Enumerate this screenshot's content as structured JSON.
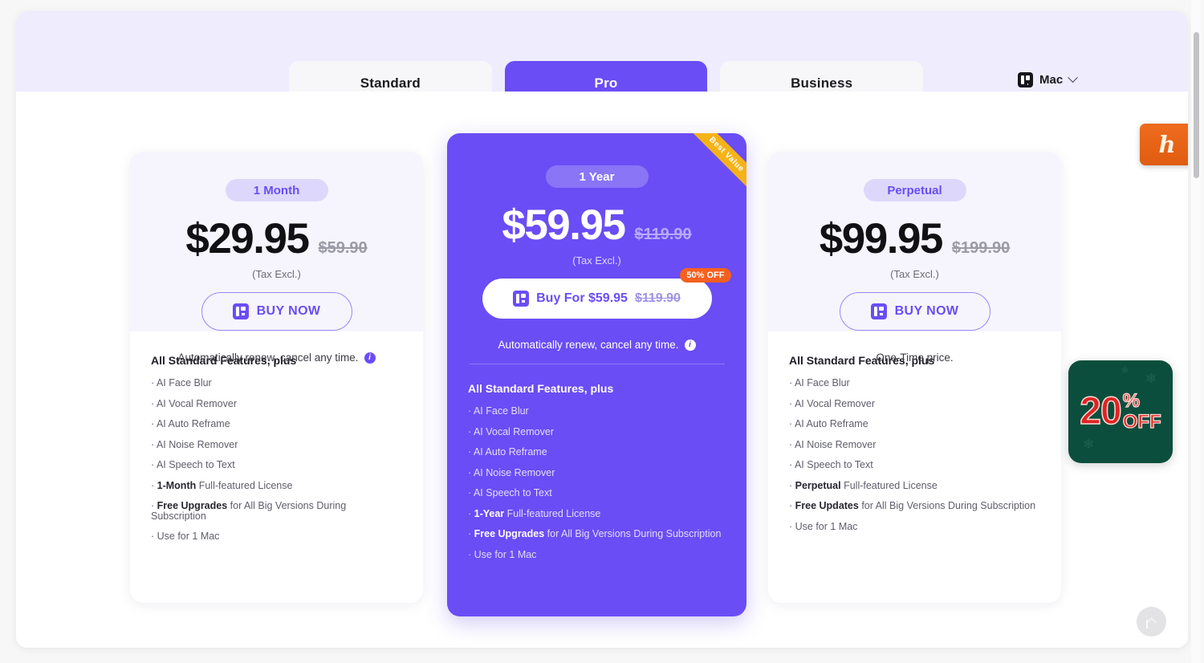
{
  "header": {
    "tabs": [
      {
        "label": "Standard",
        "active": false
      },
      {
        "label": "Pro",
        "active": true
      },
      {
        "label": "Business",
        "active": false
      }
    ],
    "platform": {
      "label": "Mac",
      "icon": "app-logo-icon",
      "chevron": "chevron-down-icon"
    }
  },
  "plans": [
    {
      "term": "1 Month",
      "price": "$29.95",
      "price_old": "$59.90",
      "tax_note": "(Tax Excl.)",
      "cta": "BUY NOW",
      "renew_note": "Automatically renew, cancel any time.",
      "info_icon": "info-icon",
      "features_title": "All Standard Features, plus",
      "features": [
        {
          "bold": "",
          "text": "AI Face Blur"
        },
        {
          "bold": "",
          "text": "AI Vocal Remover"
        },
        {
          "bold": "",
          "text": "AI Auto Reframe"
        },
        {
          "bold": "",
          "text": "AI Noise Remover"
        },
        {
          "bold": "",
          "text": "AI Speech to Text"
        },
        {
          "bold": "1-Month",
          "text": " Full-featured License"
        },
        {
          "bold": "Free Upgrades",
          "text": " for All Big Versions During Subscription"
        },
        {
          "bold": "",
          "text": "Use for 1 Mac"
        }
      ]
    },
    {
      "term": "1 Year",
      "price": "$59.95",
      "price_old": "$119.90",
      "tax_note": "(Tax Excl.)",
      "cta": "Buy For $59.95",
      "cta_old": "$119.90",
      "discount_badge": "50% OFF",
      "ribbon": "Best Value",
      "renew_note": "Automatically renew, cancel any time.",
      "info_icon": "info-icon",
      "features_title": "All Standard Features, plus",
      "features": [
        {
          "bold": "",
          "text": "AI Face Blur"
        },
        {
          "bold": "",
          "text": "AI Vocal Remover"
        },
        {
          "bold": "",
          "text": "AI Auto Reframe"
        },
        {
          "bold": "",
          "text": "AI Noise Remover"
        },
        {
          "bold": "",
          "text": "AI Speech to Text"
        },
        {
          "bold": "1-Year",
          "text": " Full-featured License"
        },
        {
          "bold": "Free Upgrades",
          "text": " for All Big Versions During Subscription"
        },
        {
          "bold": "",
          "text": "Use for 1 Mac"
        }
      ]
    },
    {
      "term": "Perpetual",
      "price": "$99.95",
      "price_old": "$199.90",
      "tax_note": "(Tax Excl.)",
      "cta": "BUY NOW",
      "renew_note": "One-Time price.",
      "features_title": "All Standard Features, plus",
      "features": [
        {
          "bold": "",
          "text": "AI Face Blur"
        },
        {
          "bold": "",
          "text": "AI Vocal Remover"
        },
        {
          "bold": "",
          "text": "AI Auto Reframe"
        },
        {
          "bold": "",
          "text": "AI Noise Remover"
        },
        {
          "bold": "",
          "text": "AI Speech to Text"
        },
        {
          "bold": "Perpetual",
          "text": " Full-featured License"
        },
        {
          "bold": "Free Updates",
          "text": " for All Big Versions During Subscription"
        },
        {
          "bold": "",
          "text": "Use for 1 Mac"
        }
      ]
    }
  ],
  "promo_badge": {
    "number": "20",
    "percent": "%",
    "off": "OFF"
  },
  "honey_widget": {
    "glyph": "h",
    "name": "honey-icon"
  },
  "scroll_top": {
    "name": "scroll-to-top-icon"
  },
  "colors": {
    "accent": "#6a4df5",
    "accent_light": "#ddd8fb",
    "band": "#eeecfd",
    "ribbon": "#f5b318",
    "discount": "#f4601f",
    "promo_bg": "#0c4e3d",
    "promo_fg": "#e02423",
    "honey": "#ef6b1e"
  }
}
